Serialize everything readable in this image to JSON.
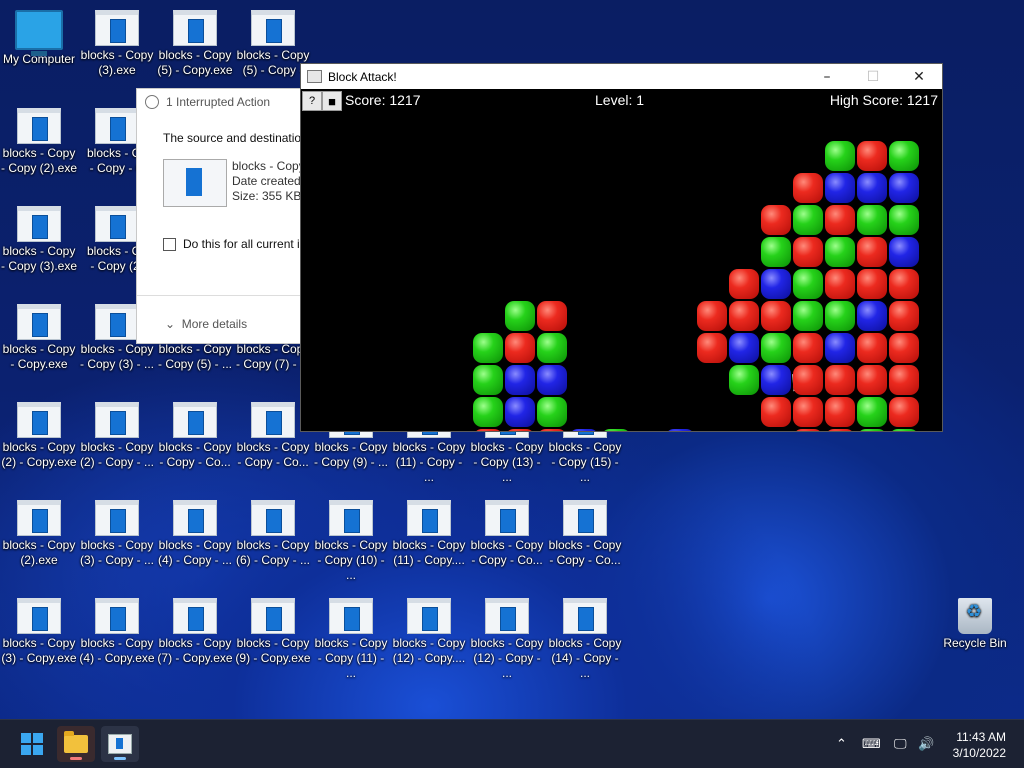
{
  "desktop": {
    "icons": [
      {
        "label": "My Computer",
        "type": "monitor"
      },
      {
        "label": "blocks - Copy\n(3).exe",
        "type": "exe"
      },
      {
        "label": "blocks - Copy\n(5) - Copy.exe",
        "type": "exe"
      },
      {
        "label": "blocks - Copy\n(5) - Copy -",
        "type": "exe"
      },
      {
        "label": "blocks - Copy\n- Copy (2).exe",
        "type": "exe"
      },
      {
        "label": "blocks - Co\n- Copy - C",
        "type": "exe"
      },
      {
        "label": "blocks - Copy\n- Copy (3).exe",
        "type": "exe"
      },
      {
        "label": "blocks - Co\n- Copy (2)",
        "type": "exe"
      },
      {
        "label": "blocks - Copy\n- Copy.exe",
        "type": "exe"
      },
      {
        "label": "blocks - Copy\n- Copy (3) - ...",
        "type": "exe"
      },
      {
        "label": "blocks - Copy\n- Copy (5) - ...",
        "type": "exe"
      },
      {
        "label": "blocks - Copy\n- Copy (7) - ...",
        "type": "exe"
      },
      {
        "label": "blocks - Copy\n(2) - Copy.exe",
        "type": "exe"
      },
      {
        "label": "blocks - Copy\n(2) - Copy - ...",
        "type": "exe"
      },
      {
        "label": "blocks - Copy\n- Copy - Co...",
        "type": "exe"
      },
      {
        "label": "blocks - Copy\n- Copy - Co...",
        "type": "exe"
      },
      {
        "label": "blocks - Copy\n- Copy (9) - ...",
        "type": "exe"
      },
      {
        "label": "blocks - Copy\n(11) - Copy - ...",
        "type": "exe"
      },
      {
        "label": "blocks - Copy\n- Copy (13) - ...",
        "type": "exe"
      },
      {
        "label": "blocks - Copy\n- Copy (15) - ...",
        "type": "exe"
      },
      {
        "label": "blocks - Copy\n(2).exe",
        "type": "exe"
      },
      {
        "label": "blocks - Copy\n(3) - Copy - ...",
        "type": "exe"
      },
      {
        "label": "blocks - Copy\n(4) - Copy - ...",
        "type": "exe"
      },
      {
        "label": "blocks - Copy\n(6) - Copy - ...",
        "type": "exe"
      },
      {
        "label": "blocks - Copy\n- Copy (10) - ...",
        "type": "exe"
      },
      {
        "label": "blocks - Copy\n(11) - Copy....",
        "type": "exe"
      },
      {
        "label": "blocks - Copy\n- Copy - Co...",
        "type": "exe"
      },
      {
        "label": "blocks - Copy\n- Copy - Co...",
        "type": "exe"
      },
      {
        "label": "blocks - Copy\n(3) - Copy.exe",
        "type": "exe"
      },
      {
        "label": "blocks - Copy\n(4) - Copy.exe",
        "type": "exe"
      },
      {
        "label": "blocks - Copy\n(7) - Copy.exe",
        "type": "exe"
      },
      {
        "label": "blocks - Copy\n(9) - Copy.exe",
        "type": "exe"
      },
      {
        "label": "blocks - Copy\n- Copy (11) - ...",
        "type": "exe"
      },
      {
        "label": "blocks - Copy\n(12) - Copy....",
        "type": "exe"
      },
      {
        "label": "blocks - Copy\n(12) - Copy - ...",
        "type": "exe"
      },
      {
        "label": "blocks - Copy\n(14) - Copy - ...",
        "type": "exe"
      },
      {
        "label": "Recycle Bin",
        "type": "bin"
      }
    ]
  },
  "dialog": {
    "title": "1 Interrupted Action",
    "message": "The source and destination",
    "file_name": "blocks - Copy",
    "date_label": "Date created:",
    "size": "Size: 355 KB",
    "checkbox_label": "Do this for all current it",
    "more_details": "More details"
  },
  "game_window": {
    "title": "Block Attack!",
    "minimize": "–",
    "maximize": "☐",
    "close": "✕",
    "help_button": "?",
    "stop_button": "■",
    "score": "Score: 1217",
    "level": "Level: 1",
    "high_score": "High Score: 1217",
    "board": [
      [
        "red",
        "red",
        "red",
        "blue",
        "green"
      ],
      [
        "green",
        "green",
        "green",
        "green",
        "red"
      ]
    ]
  },
  "taskbar": {
    "time": "11:43 AM",
    "date": "3/10/2022",
    "tray_icons": [
      "chevron-up-icon",
      "keyboard-icon",
      "network-icon",
      "volume-icon"
    ]
  }
}
